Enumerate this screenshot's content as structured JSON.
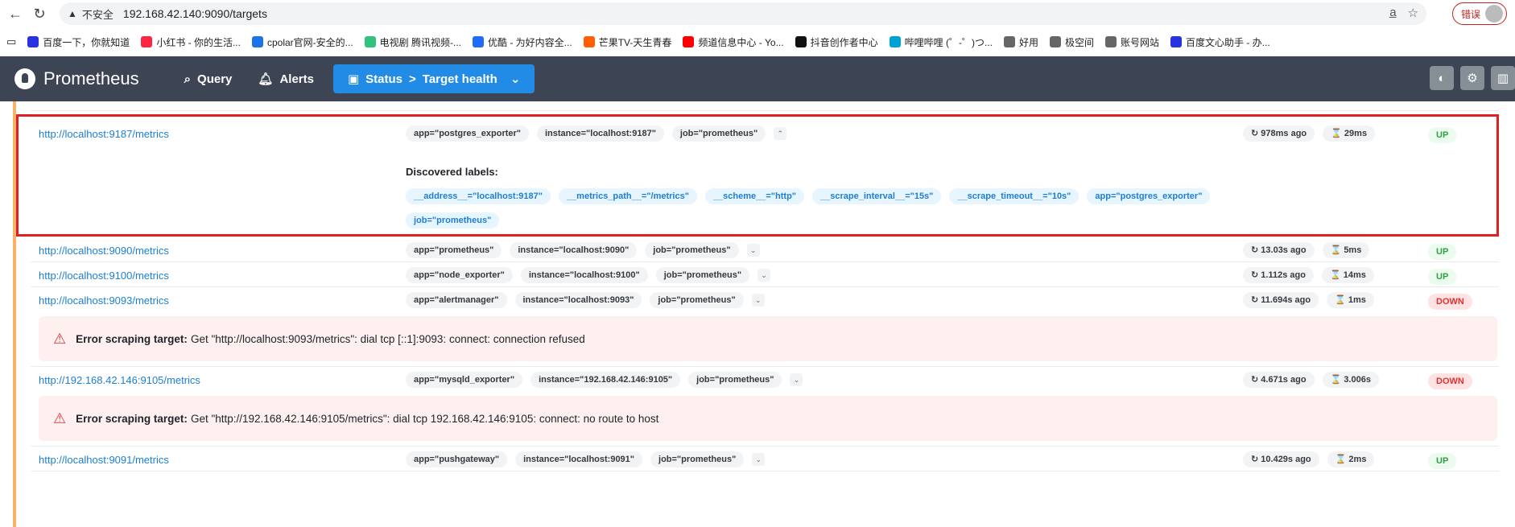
{
  "browser": {
    "security_label": "不安全",
    "url": "192.168.42.140:9090/targets",
    "error_button": "错误"
  },
  "bookmarks": [
    {
      "label": "百度一下，你就知道",
      "color": "#2932e1"
    },
    {
      "label": "小红书 - 你的生活...",
      "color": "#ff2442"
    },
    {
      "label": "cpolar官网-安全的...",
      "color": "#1a73e8"
    },
    {
      "label": "电视剧 腾讯视频-...",
      "color": "#31c27c"
    },
    {
      "label": "优酷 - 为好内容全...",
      "color": "#1f6bff"
    },
    {
      "label": "芒果TV-天生青春",
      "color": "#ff5f00"
    },
    {
      "label": "频道信息中心 - Yo...",
      "color": "#ff0000"
    },
    {
      "label": "抖音创作者中心",
      "color": "#111111"
    },
    {
      "label": "哔哩哔哩 (゜-゜)つ...",
      "color": "#00a1d6"
    },
    {
      "label": "好用",
      "color": "#666666"
    },
    {
      "label": "极空间",
      "color": "#666666"
    },
    {
      "label": "账号网站",
      "color": "#666666"
    },
    {
      "label": "百度文心助手 - 办...",
      "color": "#2932e1"
    }
  ],
  "nav": {
    "brand": "Prometheus",
    "query": "Query",
    "alerts": "Alerts",
    "status": "Status",
    "status_sep": ">",
    "status_page": "Target health"
  },
  "discovered_title": "Discovered labels:",
  "discovered_labels": [
    "__address__=\"localhost:9187\"",
    "__metrics_path__=\"/metrics\"",
    "__scheme__=\"http\"",
    "__scrape_interval__=\"15s\"",
    "__scrape_timeout__=\"10s\"",
    "app=\"postgres_exporter\"",
    "job=\"prometheus\""
  ],
  "error_prefix": "Error scraping target:",
  "targets": [
    {
      "endpoint": "http://localhost:9187/metrics",
      "labels": [
        "app=\"postgres_exporter\"",
        "instance=\"localhost:9187\"",
        "job=\"prometheus\""
      ],
      "last_scrape": "978ms ago",
      "duration": "29ms",
      "state": "UP"
    },
    {
      "endpoint": "http://localhost:9090/metrics",
      "labels": [
        "app=\"prometheus\"",
        "instance=\"localhost:9090\"",
        "job=\"prometheus\""
      ],
      "last_scrape": "13.03s ago",
      "duration": "5ms",
      "state": "UP"
    },
    {
      "endpoint": "http://localhost:9100/metrics",
      "labels": [
        "app=\"node_exporter\"",
        "instance=\"localhost:9100\"",
        "job=\"prometheus\""
      ],
      "last_scrape": "1.112s ago",
      "duration": "14ms",
      "state": "UP"
    },
    {
      "endpoint": "http://localhost:9093/metrics",
      "labels": [
        "app=\"alertmanager\"",
        "instance=\"localhost:9093\"",
        "job=\"prometheus\""
      ],
      "last_scrape": "11.694s ago",
      "duration": "1ms",
      "state": "DOWN",
      "error": "Get \"http://localhost:9093/metrics\": dial tcp [::1]:9093: connect: connection refused"
    },
    {
      "endpoint": "http://192.168.42.146:9105/metrics",
      "labels": [
        "app=\"mysqld_exporter\"",
        "instance=\"192.168.42.146:9105\"",
        "job=\"prometheus\""
      ],
      "last_scrape": "4.671s ago",
      "duration": "3.006s",
      "state": "DOWN",
      "error": "Get \"http://192.168.42.146:9105/metrics\": dial tcp 192.168.42.146:9105: connect: no route to host"
    },
    {
      "endpoint": "http://localhost:9091/metrics",
      "labels": [
        "app=\"pushgateway\"",
        "instance=\"localhost:9091\"",
        "job=\"prometheus\""
      ],
      "last_scrape": "10.429s ago",
      "duration": "2ms",
      "state": "UP"
    }
  ]
}
